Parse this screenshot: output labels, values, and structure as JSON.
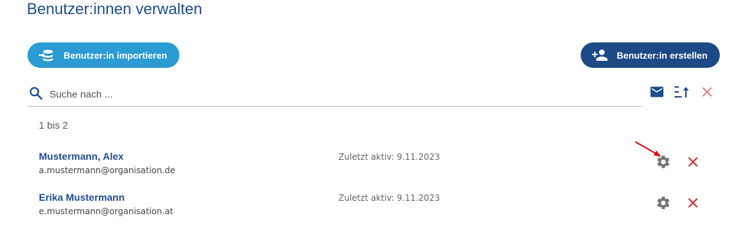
{
  "page": {
    "title": "Benutzer:innen verwalten"
  },
  "actions": {
    "import_label": "Benutzer:in importieren",
    "create_label": "Benutzer:in erstellen"
  },
  "search": {
    "placeholder": "Suche nach ..."
  },
  "toolbar": {
    "icons": [
      "mail-icon",
      "sort-icon",
      "clear-icon"
    ]
  },
  "results": {
    "count_label": "1 bis 2"
  },
  "users": [
    {
      "name": "Mustermann, Alex",
      "email": "a.mustermann@organisation.de",
      "last_active": "Zuletzt aktiv: 9.11.2023"
    },
    {
      "name": "Erika Mustermann",
      "email": "e.mustermann@organisation.at",
      "last_active": "Zuletzt aktiv: 9.11.2023"
    }
  ],
  "colors": {
    "title": "#1f4d8f",
    "import_button": "#2b9bd3",
    "create_button": "#1d4a86",
    "delete": "#d32f2f",
    "gear": "#757575",
    "annotation_arrow": "#e01010"
  }
}
